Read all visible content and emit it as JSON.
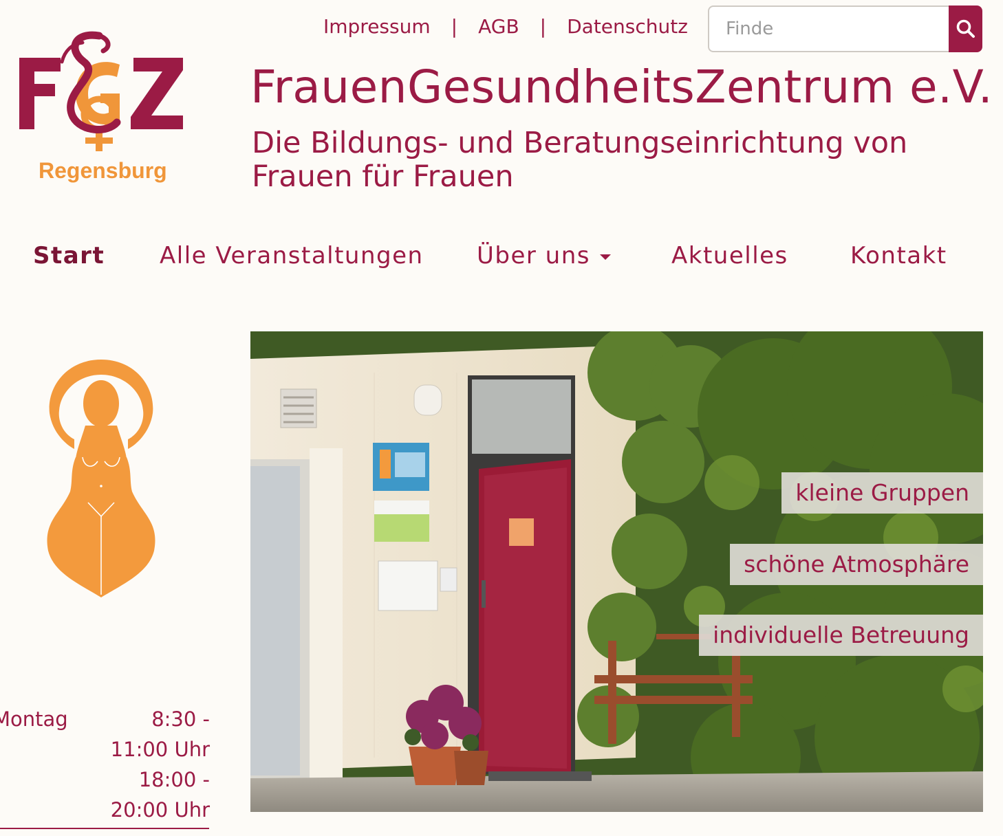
{
  "top_links": [
    "Impressum",
    "AGB",
    "Datenschutz"
  ],
  "search": {
    "placeholder": "Finde"
  },
  "logo": {
    "letters": "F&GZ",
    "city": "Regensburg"
  },
  "title": "FrauenGesundheitsZentrum e.V.",
  "subtitle": "Die Bildungs- und Beratungseinrichtung von Frauen für Frauen",
  "nav": [
    {
      "label": "Start",
      "active": true
    },
    {
      "label": "Alle Veranstaltungen"
    },
    {
      "label": "Über uns",
      "dropdown": true
    },
    {
      "label": "Aktuelles"
    },
    {
      "label": "Kontakt"
    }
  ],
  "hours": {
    "day": "Montag",
    "times": [
      "8:30 -",
      "11:00 Uhr",
      "18:00 -",
      "20:00 Uhr"
    ]
  },
  "hero_tags": [
    "kleine Gruppen",
    "schöne Atmosphäre",
    "individuelle Betreuung"
  ],
  "colors": {
    "brand": "#9b1b45",
    "accent": "#f0963a",
    "background": "#fdfbf7"
  }
}
